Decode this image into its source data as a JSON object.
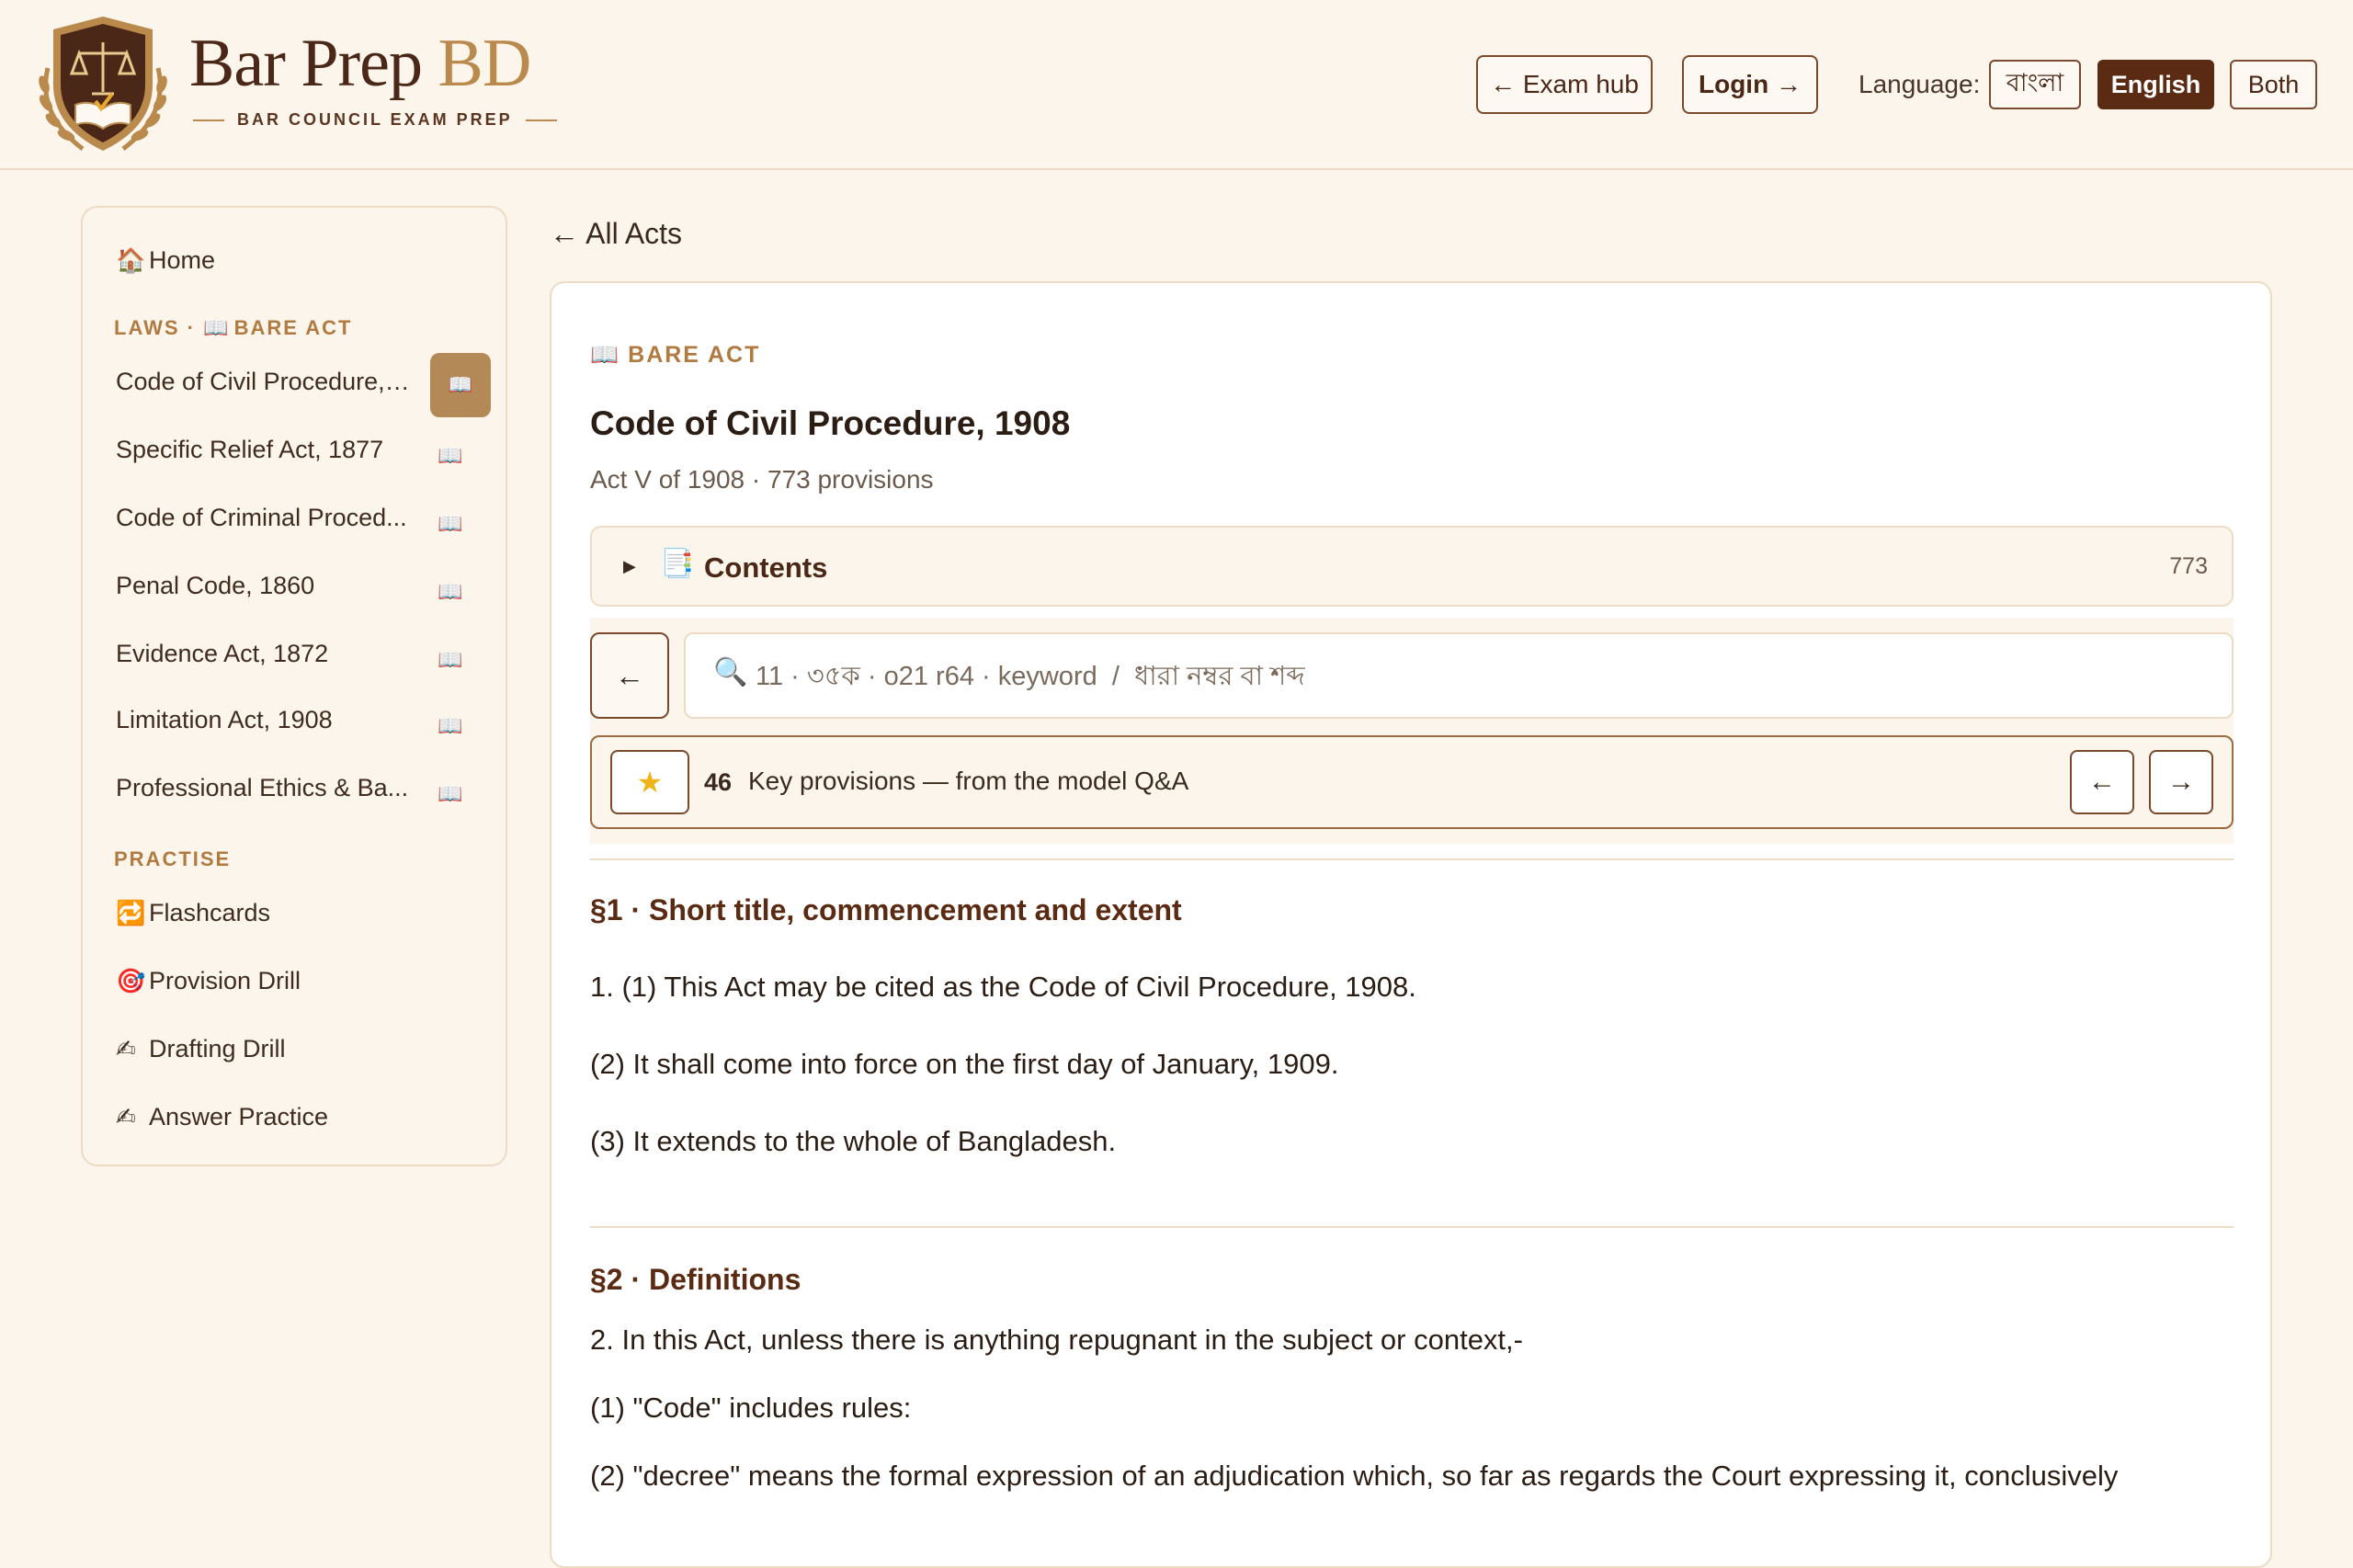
{
  "header": {
    "brand_main": "Bar Prep ",
    "brand_accent": "BD",
    "brand_tagline": "BAR COUNCIL EXAM PREP",
    "exam_hub_label": "← Exam hub",
    "login_label": "Login →",
    "language_label": "Language:",
    "languages": [
      {
        "label": "বাংলা",
        "selected": false
      },
      {
        "label": "English",
        "selected": true
      },
      {
        "label": "Both",
        "selected": false
      }
    ]
  },
  "sidebar": {
    "home": {
      "label": "Home",
      "icon": "house-icon"
    },
    "laws_heading_prefix": "LAWS · ",
    "laws_heading_suffix": "BARE ACT",
    "laws": [
      {
        "label": "Code of Civil Procedure, ...",
        "active": true
      },
      {
        "label": "Specific Relief Act, 1877",
        "active": false
      },
      {
        "label": "Code of Criminal Proced...",
        "active": false
      },
      {
        "label": "Penal Code, 1860",
        "active": false
      },
      {
        "label": "Evidence Act, 1872",
        "active": false
      },
      {
        "label": "Limitation Act, 1908",
        "active": false
      },
      {
        "label": "Professional Ethics & Ba...",
        "active": false
      }
    ],
    "practise_heading": "PRACTISE",
    "practise": [
      {
        "label": "Flashcards",
        "icon": "repeat-icon"
      },
      {
        "label": "Provision Drill",
        "icon": "target-icon"
      },
      {
        "label": "Drafting Drill",
        "icon": "writing-hand-icon"
      },
      {
        "label": "Answer Practice",
        "icon": "writing-hand-icon"
      }
    ]
  },
  "main": {
    "back_link": "← All Acts",
    "kicker": "BARE ACT",
    "title": "Code of Civil Procedure, 1908",
    "subtitle": "Act V of 1908 · 773 provisions",
    "contents_label": "Contents",
    "contents_count": "773",
    "search_back": "←",
    "search_placeholder": "11 · ৩৫ক · o21 r64 · keyword  /  ধারা নম্বর বা শব্দ",
    "search_value": "",
    "key_provisions_count": "46",
    "key_provisions_text": "Key provisions — from the model Q&A",
    "prev": "←",
    "next": "→",
    "sections": [
      {
        "heading": "§1 · Short title, commencement and extent",
        "paragraphs": [
          "1. (1) This Act may be cited as the Code of Civil Procedure, 1908.",
          "(2) It shall come into force on the first day of January, 1909.",
          "(3) It extends to the whole of Bangladesh."
        ]
      },
      {
        "heading": "§2 · Definitions",
        "paragraphs": [
          "2. In this Act, unless there is anything repugnant in the subject or context,-",
          "(1) \"Code\" includes rules:",
          "(2) \"decree\" means the formal expression of an adjudication which, so far as regards the Court expressing it, conclusively"
        ]
      }
    ]
  },
  "colors": {
    "accent_brown": "#5b2a12",
    "accent_gold": "#b98a4c",
    "background": "#fbf5ec"
  }
}
